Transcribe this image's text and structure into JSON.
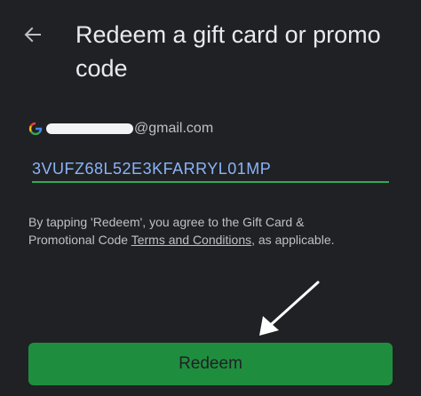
{
  "header": {
    "title": "Redeem a gift card or promo code",
    "back_icon": "arrow-left-icon"
  },
  "account": {
    "email_domain": "@gmail.com",
    "logo": "google-g-icon"
  },
  "code_input": {
    "value": "3VUFZ68L52E3KFARRYL01MP"
  },
  "terms": {
    "prefix": "By tapping 'Redeem', you agree to the Gift Card & Promotional Code ",
    "link": "Terms and Conditions",
    "suffix": ", as applicable."
  },
  "annotation": {
    "icon": "pointer-arrow-icon",
    "color": "#ffffff"
  },
  "actions": {
    "redeem_label": "Redeem"
  },
  "colors": {
    "background": "#202124",
    "accent_green": "#1e8e3e",
    "input_underline": "#34a853",
    "code_text": "#8ab4f8"
  }
}
